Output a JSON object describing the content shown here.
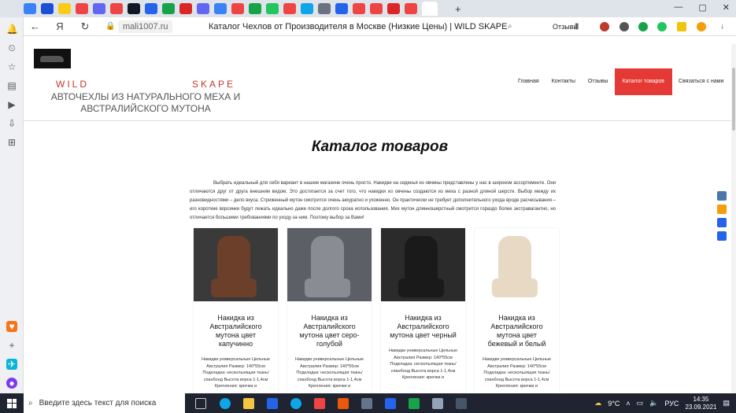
{
  "browser": {
    "tab_icons": [
      {
        "name": "tab-mail-icon",
        "color": "#3b82f6"
      },
      {
        "name": "tab-u-icon",
        "color": "#1d4ed8"
      },
      {
        "name": "tab-taxi-icon",
        "color": "#facc15"
      },
      {
        "name": "tab-yandex-icon",
        "color": "#ef4444"
      },
      {
        "name": "tab-page-icon",
        "color": "#6366f1"
      },
      {
        "name": "tab-yandex-icon",
        "color": "#ef4444"
      },
      {
        "name": "tab-v-icon",
        "color": "#111827"
      },
      {
        "name": "tab-grid-icon",
        "color": "#2563eb"
      },
      {
        "name": "tab-plus-icon",
        "color": "#16a34a"
      },
      {
        "name": "tab-doc-icon",
        "color": "#dc2626"
      },
      {
        "name": "tab-z-icon",
        "color": "#6366f1"
      },
      {
        "name": "tab-page-icon",
        "color": "#3b82f6"
      },
      {
        "name": "tab-yandex-icon",
        "color": "#ef4444"
      },
      {
        "name": "tab-c-icon",
        "color": "#16a34a"
      },
      {
        "name": "tab-c-icon",
        "color": "#22c55e"
      },
      {
        "name": "tab-yandex-icon",
        "color": "#ef4444"
      },
      {
        "name": "tab-arrow-icon",
        "color": "#0ea5e9"
      },
      {
        "name": "tab-book-icon",
        "color": "#6b7280"
      },
      {
        "name": "tab-shield-icon",
        "color": "#2563eb"
      },
      {
        "name": "tab-yandex-icon",
        "color": "#ef4444"
      },
      {
        "name": "tab-yandex-icon",
        "color": "#ef4444"
      },
      {
        "name": "tab-diamond-icon",
        "color": "#dc2626"
      },
      {
        "name": "tab-yandex-icon",
        "color": "#ef4444"
      }
    ],
    "url": "mali1007.ru",
    "page_title": "Каталог Чехлов от Производителя в Москве (Низкие Цены) | WILD SKAPE",
    "reviews_label": "Отзывы"
  },
  "site": {
    "brand_left": "WILD",
    "brand_right": "SKAPE",
    "slogan": "АВТОЧЕХЛЫ ИЗ НАТУРАЛЬНОГО МЕХА И АВСТРАЛИЙСКОГО МУТОНА",
    "menu": [
      {
        "label": "Главная",
        "active": false
      },
      {
        "label": "Контакты",
        "active": false
      },
      {
        "label": "Отзывы",
        "active": false
      },
      {
        "label": "Каталог товаров",
        "active": true
      },
      {
        "label": "Связаться с нами",
        "active": false
      }
    ],
    "accent": "#e53935"
  },
  "catalog": {
    "heading": "Каталог товаров",
    "intro": "Выбрать идеальный для себя вариант в нашем магазине очень просто. Накидки на сиденья из овчины представлены у нас в широком ассортименте. Они отличаются друг от друга внешним видом. Это достигается за счет того, что накидки из овчины создаются из меха с разной длиной шерсти. Выбор между их разновидностями – дело вкуса. Стриженный мутон смотрится очень аккуратно и ухоженно. Он практически не требует дополнительного ухода вроде расчесывания – его короткие ворсинки будут лежать идеально даже после долгого срока использования. Мех мутон длинношерстный смотрится гораздо более экстравагантно, но отличается большими требованиями по уходу за ним. Поэтому выбор за Вами!",
    "products": [
      {
        "title": "Накидка из Австралийского мутона  цвет капучинно",
        "desc": "Накидки универсальные Цельные Австралия Размер: 140*55см Подкладка: нескользящая ткань/спанбонд Высота ворса 1-1,4см Крепления: крючки и",
        "fur_color": "#6b3f2a",
        "bg_color": "#3a3a3a"
      },
      {
        "title": "Накидка из Австралийского мутона  цвет серо-голубой",
        "desc": "Накидки универсальные Цельные Австралия Размер: 140*55см Подкладка: нескользящая ткань/спанбонд Высота ворса 1-1,4см Крепления: крючки и",
        "fur_color": "#8a8c94",
        "bg_color": "#5c5f66"
      },
      {
        "title": "Накидка из Австралийского мутона цвет черный",
        "desc": "Накидки универсальные Цельные Австралия Размер: 140*55см Подкладка: нескользящая ткань/спанбонд Высота ворса 1-1,4см Крепления: крючки и",
        "fur_color": "#1a1a1a",
        "bg_color": "#2b2b2b"
      },
      {
        "title": "Накидка из Австралийского мутона цвет бежевый и белый",
        "desc": "Накидки универсальные Цельные Австралия Размер: 140*55см Подкладка: нескользящая ткань/спанбонд Высота ворса 1-1,4см Крепления: крючки и",
        "fur_color": "#e8d9c4",
        "bg_color": "#ffffff"
      }
    ]
  },
  "taskbar": {
    "search_placeholder": "Введите здесь текст для поиска",
    "temperature": "9°C",
    "language": "РУС",
    "time": "14:35",
    "date": "23.09.2021"
  }
}
